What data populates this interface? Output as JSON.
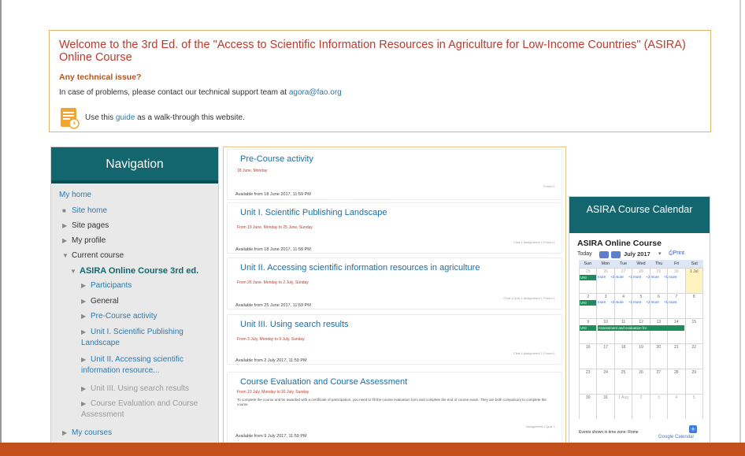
{
  "welcome": {
    "title": "Welcome to the 3rd Ed. of the \"Access to Scientific Information Resources in Agriculture for Low-Income Countries\" (ASIRA) Online Course",
    "issue_heading": "Any technical issue?",
    "support_text": "In case of problems, please contact our technical support team at",
    "support_email": "agora@fao.org",
    "guide_prefix": "Use this",
    "guide_link": "guide",
    "guide_suffix": "as a walk-through this website."
  },
  "navigation": {
    "title": "Navigation",
    "my_home": "My home",
    "site_home": "Site home",
    "site_pages": "Site pages",
    "my_profile": "My profile",
    "current_course": "Current course",
    "course_name": "ASIRA Online Course 3rd ed.",
    "items": [
      "Participants",
      "General",
      "Pre-Course activity",
      "Unit I. Scientific Publishing Landscape",
      "Unit II. Accessing scientific information resource...",
      "Unit III. Using search results",
      "Course Evaluation and Course Assessment"
    ],
    "my_courses": "My courses"
  },
  "sections": [
    {
      "title": "Pre-Course activity",
      "date": "18 June, Monday",
      "links": "Forum 1",
      "available": "Available from 18 June 2017, 11:59 PM"
    },
    {
      "title": "Unit I. Scientific Publishing Landscape",
      "date": "From 19 June, Monday to 25 June, Sunday",
      "links": "Chat 1  Assignment 1  Forum 1",
      "available": "Available from 18 June 2017, 11:59 PM"
    },
    {
      "title": "Unit II. Accessing scientific information resources in agriculture",
      "date": "From 26 June, Monday to 2 July, Sunday",
      "links": "Chat 1  Quiz 1  Assignment 1  Forum 1",
      "available": "Available from 25 June 2017, 11:59 PM"
    },
    {
      "title": "Unit III. Using search results",
      "date": "From 3 July, Monday to 9 July, Sunday",
      "links": "Chat 1  Assignment 1  Forum 1",
      "available": "Available from 2 July 2017, 11:59 PM"
    },
    {
      "title": "Course Evaluation and Course Assessment",
      "date": "From 10 July, Monday to 16 July, Sunday",
      "description": "To complete the course and be awarded with a certificate of participation, you need to fill the course evaluation form and complete the end of course exam. They are both compulsory to complete the course.",
      "links": "Assignment 1  Quiz 1",
      "available": "Available from 9 July 2017, 11:59 PM"
    }
  ],
  "calendar": {
    "block_title": "ASIRA Course Calendar",
    "title": "ASIRA Online Course",
    "today_label": "Today",
    "month_label": "July 2017",
    "print_label": "Print",
    "weekdays": [
      "Sun",
      "Mon",
      "Tue",
      "Wed",
      "Thu",
      "Fri",
      "Sat"
    ],
    "weeks": [
      [
        "25",
        "26",
        "27",
        "28",
        "29",
        "30",
        "1 Jul"
      ],
      [
        "2",
        "3",
        "4",
        "5",
        "6",
        "7",
        "8"
      ],
      [
        "9",
        "10",
        "11",
        "12",
        "13",
        "14",
        "15"
      ],
      [
        "16",
        "17",
        "18",
        "19",
        "20",
        "21",
        "22"
      ],
      [
        "23",
        "24",
        "25",
        "26",
        "27",
        "28",
        "29"
      ],
      [
        "30",
        "31",
        "1 Aug",
        "2",
        "3",
        "4",
        "5"
      ]
    ],
    "event_unit_label": "UNI",
    "more_label": "+1 more",
    "more_labels": [
      "+1 more",
      "+2 more",
      "+1 more",
      "+2 more",
      "+1 more"
    ],
    "assessment_event": "Assessment and evaluation for",
    "footer_text": "Events shown in time zone: Rome",
    "google_label": "Google Calendar",
    "accent": "#14666e"
  }
}
